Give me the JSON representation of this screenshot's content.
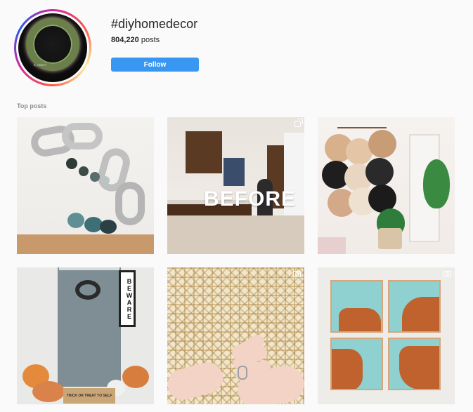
{
  "header": {
    "hashtag": "#diyhomedecor",
    "post_count": "804,220",
    "post_count_suffix": "posts",
    "follow_label": "Follow"
  },
  "avatar": {
    "caption": "B_CRAFT"
  },
  "section": {
    "top_posts_label": "Top posts"
  },
  "posts": [
    {
      "id": "post-1",
      "description": "chain garland with pumpkins",
      "type": "photo"
    },
    {
      "id": "post-2",
      "description": "kitchen before",
      "type": "carousel",
      "overlay_text": "BEFORE"
    },
    {
      "id": "post-3",
      "description": "hat wall and plants",
      "type": "photo"
    },
    {
      "id": "post-4",
      "description": "front door with pumpkins",
      "type": "photo",
      "sign_text": "BEWARE",
      "mat_text": "TRICK OR TREAT YO SELF"
    },
    {
      "id": "post-5",
      "description": "cane webbing",
      "type": "video"
    },
    {
      "id": "post-6",
      "description": "resin coasters",
      "type": "video"
    }
  ],
  "colors": {
    "accent": "#3897f0",
    "background": "#fafafa",
    "text": "#262626",
    "muted": "#8e8e8e"
  }
}
